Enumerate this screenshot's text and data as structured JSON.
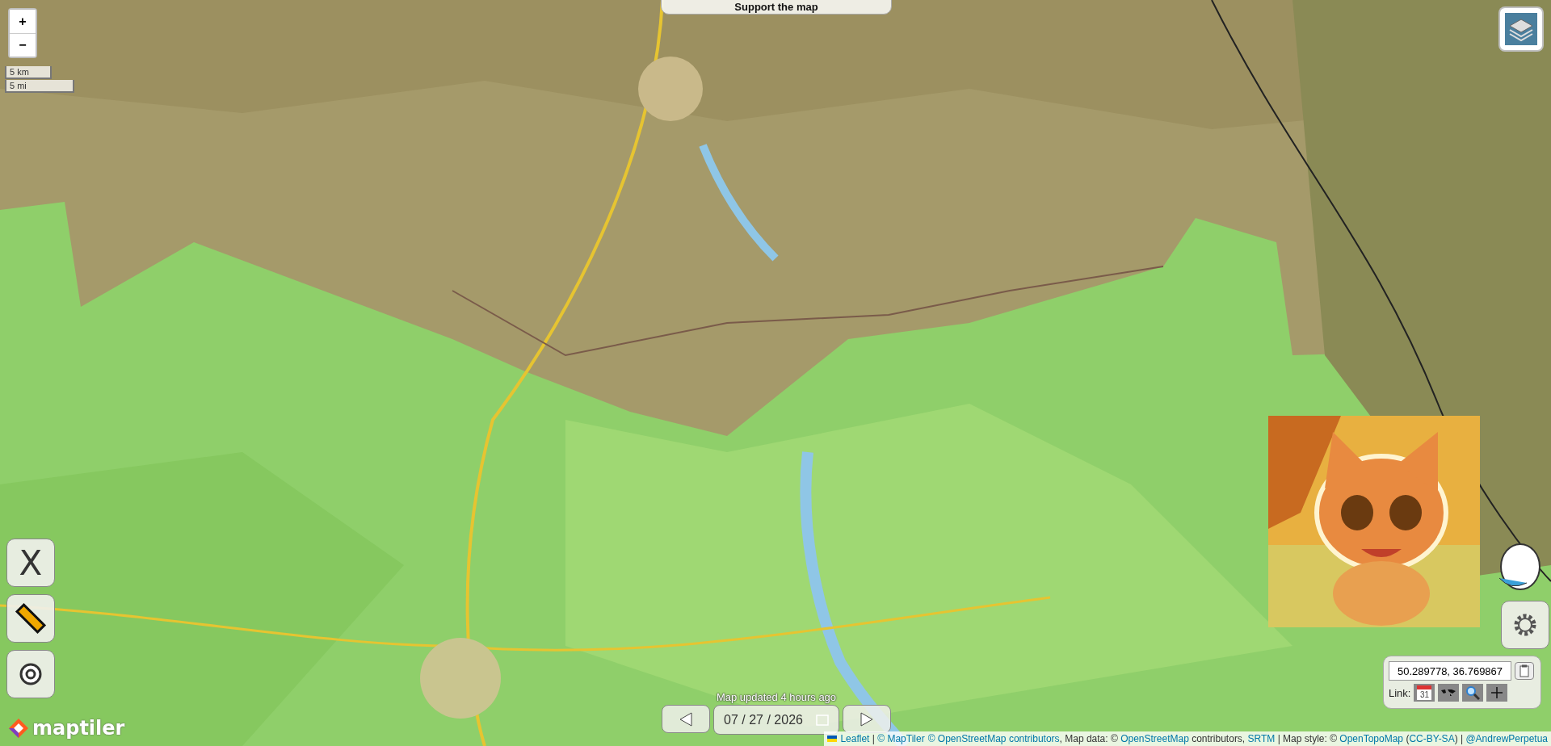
{
  "zoom_controls": [
    "+",
    "−"
  ],
  "scale": [
    "5 km",
    "5 mi"
  ],
  "support_button": "Support the map",
  "tool_buttons": [
    {
      "kind": "x",
      "label": "X"
    },
    {
      "kind": "ruler"
    },
    {
      "kind": "target"
    }
  ],
  "logo": "maptiler",
  "date_nav": {
    "updated": "Map updated 4 hours ago",
    "date": "07 / 27 / 2026"
  },
  "coordinates": {
    "value": "50.289778, 36.769867",
    "link_label": "Link:",
    "calendar_day": "31"
  },
  "attribution": [
    {
      "text": "Leaflet",
      "link": true
    },
    {
      "text": " | ",
      "link": false
    },
    {
      "text": "© MapTiler",
      "link": true
    },
    {
      "text": "© OpenStreetMap contributors",
      "link": true
    },
    {
      "text": ", Map data: © ",
      "link": false
    },
    {
      "text": "OpenStreetMap",
      "link": true
    },
    {
      "text": " contributors, ",
      "link": false
    },
    {
      "text": "SRTM",
      "link": true
    },
    {
      "text": " | Map style: © ",
      "link": false
    },
    {
      "text": "OpenTopoMap",
      "link": true
    },
    {
      "text": " (",
      "link": false
    },
    {
      "text": "CC-BY-SA",
      "link": true
    },
    {
      "text": ") | ",
      "link": false
    },
    {
      "text": "@AndrewPerpetua",
      "link": true
    }
  ]
}
